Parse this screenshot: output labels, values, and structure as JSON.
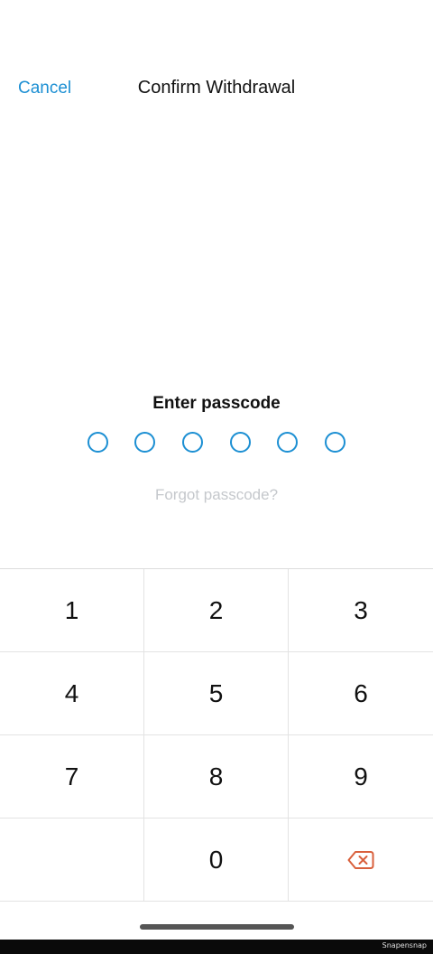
{
  "header": {
    "cancel_label": "Cancel",
    "title": "Confirm Withdrawal"
  },
  "passcode": {
    "prompt": "Enter passcode",
    "digits_entered": 0,
    "length": 6,
    "forgot_label": "Forgot passcode?"
  },
  "keypad": {
    "keys": [
      "1",
      "2",
      "3",
      "4",
      "5",
      "6",
      "7",
      "8",
      "9",
      "",
      "0",
      "backspace-icon"
    ]
  },
  "colors": {
    "accent": "#1c8fd3",
    "backspace": "#d9603c",
    "muted_text": "#c5c8cc"
  },
  "footer": {
    "watermark": "Snapensnap"
  }
}
